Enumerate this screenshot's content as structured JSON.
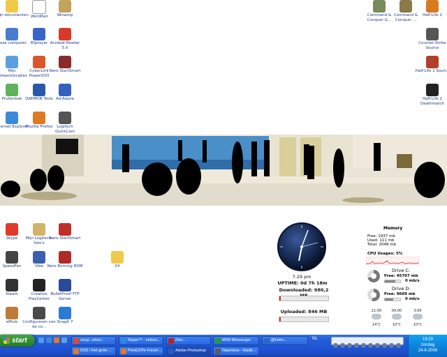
{
  "desktop_icons": [
    {
      "label": "Mijn documenten",
      "icon": "folder-documents-icon",
      "color": "#f0c94a"
    },
    {
      "label": "WordPad",
      "icon": "wordpad-icon",
      "color": "#ffffff"
    },
    {
      "label": "Winamp",
      "icon": "winamp-icon",
      "color": "#c2a35b"
    },
    {
      "label": "Deze computer",
      "icon": "my-computer-icon",
      "color": "#4a7bd0"
    },
    {
      "label": "BSplayer",
      "icon": "bsplayer-icon",
      "color": "#3a63c9"
    },
    {
      "label": "Acrobat Reader 5.0",
      "icon": "acrobat-reader-icon",
      "color": "#d83a2a"
    },
    {
      "label": "Mijn netwerklocaties",
      "icon": "network-places-icon",
      "color": "#5aa0e0"
    },
    {
      "label": "CyberLink PowerDVD",
      "icon": "powerdvd-icon",
      "color": "#d9572a"
    },
    {
      "label": "Nero StartSmart",
      "icon": "nero-icon",
      "color": "#8a2a2a"
    },
    {
      "label": "Prullenbak",
      "icon": "recycle-bin-icon",
      "color": "#5fb35a"
    },
    {
      "label": "DAEMON Tools",
      "icon": "daemon-tools-icon",
      "color": "#2a58a8"
    },
    {
      "label": "Ad-Aware",
      "icon": "adaware-icon",
      "color": "#3460c0"
    },
    {
      "label": "Internet Explorer",
      "icon": "internet-explorer-icon",
      "color": "#3a8ad8"
    },
    {
      "label": "Mozilla Firefox",
      "icon": "firefox-icon",
      "color": "#e07a22"
    },
    {
      "label": "Logitech QuickCam",
      "icon": "quickcam-icon",
      "color": "#555555"
    },
    {
      "label": "Skype",
      "icon": "skype-icon",
      "color": "#e03a2a"
    },
    {
      "label": "Mijn Logitech-foto's",
      "icon": "logitech-photos-icon",
      "color": "#d2b36a"
    },
    {
      "label": "Nero StartSmart",
      "icon": "nero-icon",
      "color": "#c0302a"
    },
    {
      "label": "SpeedFan",
      "icon": "speedfan-icon",
      "color": "#444444"
    },
    {
      "label": "Vibe",
      "icon": "vibe-icon",
      "color": "#3a5fb0"
    },
    {
      "label": "Nero Burning ROM",
      "icon": "nero-burning-icon",
      "color": "#b02a2a"
    },
    {
      "label": "XX",
      "icon": "folder-icon",
      "color": "#f0c94a"
    },
    {
      "label": "Steam",
      "icon": "steam-icon",
      "color": "#333333"
    },
    {
      "label": "Creative PlayCenter",
      "icon": "creative-icon",
      "color": "#222222"
    },
    {
      "label": "BulletProof FTP Server",
      "icon": "ftp-server-icon",
      "color": "#2a4a9a"
    },
    {
      "label": "eMule",
      "icon": "emule-icon",
      "color": "#c07a3a"
    },
    {
      "label": "Configureren van de co...",
      "icon": "configure-icon",
      "color": "#4a4a4a"
    },
    {
      "label": "Snagit 7",
      "icon": "snagit-icon",
      "color": "#2a7ad8"
    },
    {
      "label": "Command & Conquer G...",
      "icon": "cnc-generals-icon",
      "color": "#7a8a5a"
    },
    {
      "label": "Command & Conquer ...",
      "icon": "cnc-icon",
      "color": "#8a7a4a"
    },
    {
      "label": "Half-Life 2",
      "icon": "half-life-2-icon",
      "color": "#d87a22"
    },
    {
      "label": "Counter-Strike Source",
      "icon": "counter-strike-icon",
      "color": "#555555"
    },
    {
      "label": "Half-Life 1 Source",
      "icon": "half-life-source-icon",
      "color": "#b0402a"
    },
    {
      "label": "Half-Life 2 Deathmatch",
      "icon": "hl2-deathmatch-icon",
      "color": "#222222"
    }
  ],
  "clock_gadget": {
    "time": "7:29 pm",
    "uptime": "UPTIME: 0d 7h 18m",
    "downloaded": "Downloaded: 980,2 MB",
    "uploaded": "Uploaded: 846 MB"
  },
  "memory_gadget": {
    "title": "Memory",
    "free": "Free: 1937 mb",
    "used": "Used: 111 mb",
    "total": "Total: 2048 mb",
    "cpu": "CPU Usages: 5%",
    "drive_c_label": "Drive C:",
    "drive_c_free": "Free: 45707 mb",
    "drive_c_rate": "0 mb/s",
    "drive_d_label": "Drive D:",
    "drive_d_free": "Free: 9669 mb",
    "drive_d_rate": "0 mb/s"
  },
  "weather": [
    {
      "time": "21:00",
      "temp": "14°C"
    },
    {
      "time": "00:00",
      "temp": "10°C"
    },
    {
      "time": "3:00",
      "temp": "10°C"
    }
  ],
  "taskbar": {
    "start_label": "start",
    "tasks_row1": [
      "sergi...rekon...",
      "Skype™ - nelson...",
      "(Net...",
      "MSN Messenger",
      "@hotm..."
    ],
    "tasks_row2": [
      "DSS / Het grote ...",
      "PineEZ/Fe Forum ...",
      "Adobe Photoshop",
      "Naamloos - Kladb..."
    ],
    "lang": "NL",
    "clock_time": "19:29",
    "clock_day": "zondag",
    "clock_date": "24-6-2006"
  }
}
